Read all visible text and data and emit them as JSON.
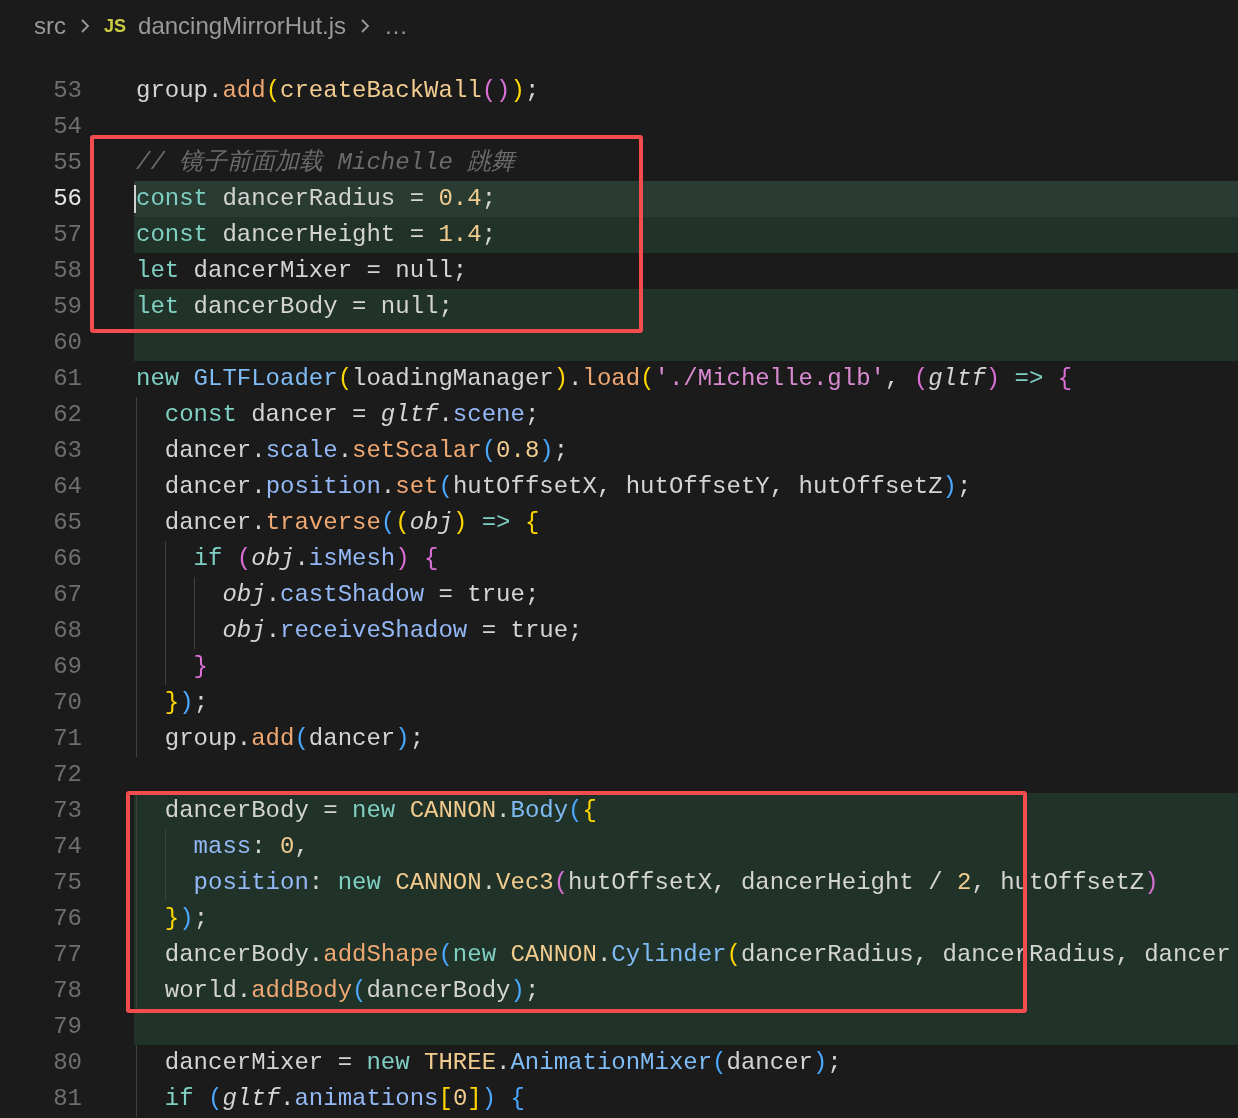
{
  "breadcrumb": {
    "folder": "src",
    "file_badge": "JS",
    "file": "dancingMirrorHut.js",
    "more": "…"
  },
  "blocks": [
    {
      "boxed": false,
      "lines": [
        {
          "number": "53",
          "current": false,
          "added": false,
          "tokens": [
            {
              "kind": "plain",
              "text": "group."
            },
            {
              "kind": "method",
              "text": "add"
            },
            {
              "kind": "b1",
              "text": "("
            },
            {
              "kind": "function",
              "text": "createBackWall"
            },
            {
              "kind": "b2",
              "text": "()"
            },
            {
              "kind": "b1",
              "text": ")"
            },
            {
              "kind": "plain",
              "text": ";"
            }
          ]
        },
        {
          "number": "54",
          "current": false,
          "added": false
        }
      ]
    },
    {
      "boxed": true,
      "lines": [
        {
          "number": "55",
          "current": false,
          "added": false,
          "tokens": [
            {
              "kind": "comment",
              "text": "// 镜子前面加载 Michelle 跳舞"
            }
          ]
        },
        {
          "number": "56",
          "current": true,
          "added": true,
          "tokens": [
            {
              "kind": "keyword",
              "text": "const "
            },
            {
              "kind": "plain",
              "text": "dancerRadius = "
            },
            {
              "kind": "number",
              "text": "0.4"
            },
            {
              "kind": "plain",
              "text": ";"
            }
          ]
        },
        {
          "number": "57",
          "current": false,
          "added": true,
          "tokens": [
            {
              "kind": "keyword",
              "text": "const "
            },
            {
              "kind": "plain",
              "text": "dancerHeight = "
            },
            {
              "kind": "number",
              "text": "1.4"
            },
            {
              "kind": "plain",
              "text": ";"
            }
          ]
        },
        {
          "number": "58",
          "current": false,
          "added": false,
          "tokens": [
            {
              "kind": "keyword",
              "text": "let "
            },
            {
              "kind": "plain",
              "text": "dancerMixer = null;"
            }
          ]
        },
        {
          "number": "59",
          "current": false,
          "added": true,
          "tokens": [
            {
              "kind": "keyword",
              "text": "let "
            },
            {
              "kind": "plain",
              "text": "dancerBody = null;"
            }
          ]
        }
      ]
    },
    {
      "boxed": false,
      "lines": [
        {
          "number": "60",
          "current": false,
          "added": true
        },
        {
          "number": "61",
          "current": false,
          "added": false,
          "tokens": [
            {
              "kind": "keyword",
              "text": "new "
            },
            {
              "kind": "class",
              "text": "GLTFLoader"
            },
            {
              "kind": "b1",
              "text": "("
            },
            {
              "kind": "plain",
              "text": "loadingManager"
            },
            {
              "kind": "b1",
              "text": ")"
            },
            {
              "kind": "plain",
              "text": "."
            },
            {
              "kind": "method",
              "text": "load"
            },
            {
              "kind": "b1",
              "text": "("
            },
            {
              "kind": "string",
              "text": "'./Michelle.glb'"
            },
            {
              "kind": "plain",
              "text": ", "
            },
            {
              "kind": "b2",
              "text": "("
            },
            {
              "kind": "param",
              "text": "gltf"
            },
            {
              "kind": "b2",
              "text": ") "
            },
            {
              "kind": "keyword",
              "text": "=> "
            },
            {
              "kind": "b2",
              "text": "{"
            }
          ]
        },
        {
          "number": "62",
          "current": false,
          "added": false,
          "tokens": [
            {
              "kind": "keyword",
              "text": "  const "
            },
            {
              "kind": "plain",
              "text": "dancer = "
            },
            {
              "kind": "param",
              "text": "gltf"
            },
            {
              "kind": "plain",
              "text": "."
            },
            {
              "kind": "property",
              "text": "scene"
            },
            {
              "kind": "plain",
              "text": ";"
            }
          ]
        },
        {
          "number": "63",
          "current": false,
          "added": false,
          "tokens": [
            {
              "kind": "plain",
              "text": "  dancer."
            },
            {
              "kind": "property",
              "text": "scale"
            },
            {
              "kind": "plain",
              "text": "."
            },
            {
              "kind": "method",
              "text": "setScalar"
            },
            {
              "kind": "b3",
              "text": "("
            },
            {
              "kind": "number",
              "text": "0.8"
            },
            {
              "kind": "b3",
              "text": ")"
            },
            {
              "kind": "plain",
              "text": ";"
            }
          ]
        },
        {
          "number": "64",
          "current": false,
          "added": false,
          "tokens": [
            {
              "kind": "plain",
              "text": "  dancer."
            },
            {
              "kind": "property",
              "text": "position"
            },
            {
              "kind": "plain",
              "text": "."
            },
            {
              "kind": "method",
              "text": "set"
            },
            {
              "kind": "b3",
              "text": "("
            },
            {
              "kind": "plain",
              "text": "hutOffsetX, hutOffsetY, hutOffsetZ"
            },
            {
              "kind": "b3",
              "text": ")"
            },
            {
              "kind": "plain",
              "text": ";"
            }
          ]
        },
        {
          "number": "65",
          "current": false,
          "added": false,
          "tokens": [
            {
              "kind": "plain",
              "text": "  dancer."
            },
            {
              "kind": "method",
              "text": "traverse"
            },
            {
              "kind": "b3",
              "text": "("
            },
            {
              "kind": "b1",
              "text": "("
            },
            {
              "kind": "param",
              "text": "obj"
            },
            {
              "kind": "b1",
              "text": ") "
            },
            {
              "kind": "keyword",
              "text": "=> "
            },
            {
              "kind": "b1",
              "text": "{"
            }
          ]
        },
        {
          "number": "66",
          "current": false,
          "added": false,
          "tokens": [
            {
              "kind": "keyword",
              "text": "    if "
            },
            {
              "kind": "b2",
              "text": "("
            },
            {
              "kind": "param",
              "text": "obj"
            },
            {
              "kind": "plain",
              "text": "."
            },
            {
              "kind": "property",
              "text": "isMesh"
            },
            {
              "kind": "b2",
              "text": ") {"
            }
          ]
        },
        {
          "number": "67",
          "current": false,
          "added": false,
          "tokens": [
            {
              "kind": "param",
              "text": "      obj"
            },
            {
              "kind": "plain",
              "text": "."
            },
            {
              "kind": "property",
              "text": "castShadow"
            },
            {
              "kind": "plain",
              "text": " = true;"
            }
          ]
        },
        {
          "number": "68",
          "current": false,
          "added": false,
          "tokens": [
            {
              "kind": "param",
              "text": "      obj"
            },
            {
              "kind": "plain",
              "text": "."
            },
            {
              "kind": "property",
              "text": "receiveShadow"
            },
            {
              "kind": "plain",
              "text": " = true;"
            }
          ]
        },
        {
          "number": "69",
          "current": false,
          "added": false,
          "tokens": [
            {
              "kind": "b2",
              "text": "    }"
            }
          ]
        },
        {
          "number": "70",
          "current": false,
          "added": false,
          "tokens": [
            {
              "kind": "b1",
              "text": "  }"
            },
            {
              "kind": "b3",
              "text": ")"
            },
            {
              "kind": "plain",
              "text": ";"
            }
          ]
        },
        {
          "number": "71",
          "current": false,
          "added": false,
          "tokens": [
            {
              "kind": "plain",
              "text": "  group."
            },
            {
              "kind": "method",
              "text": "add"
            },
            {
              "kind": "b3",
              "text": "("
            },
            {
              "kind": "plain",
              "text": "dancer"
            },
            {
              "kind": "b3",
              "text": ")"
            },
            {
              "kind": "plain",
              "text": ";"
            }
          ]
        },
        {
          "number": "72",
          "current": false,
          "added": false
        }
      ]
    },
    {
      "boxed": true,
      "lines": [
        {
          "number": "73",
          "current": false,
          "added": true,
          "tokens": [
            {
              "kind": "plain",
              "text": "  dancerBody = "
            },
            {
              "kind": "keyword",
              "text": "new "
            },
            {
              "kind": "namespace",
              "text": "CANNON"
            },
            {
              "kind": "plain",
              "text": "."
            },
            {
              "kind": "class",
              "text": "Body"
            },
            {
              "kind": "b3",
              "text": "("
            },
            {
              "kind": "b1",
              "text": "{"
            }
          ]
        },
        {
          "number": "74",
          "current": false,
          "added": true,
          "tokens": [
            {
              "kind": "property",
              "text": "    mass"
            },
            {
              "kind": "plain",
              "text": ": "
            },
            {
              "kind": "number",
              "text": "0"
            },
            {
              "kind": "plain",
              "text": ","
            }
          ]
        },
        {
          "number": "75",
          "current": false,
          "added": true,
          "tokens": [
            {
              "kind": "property",
              "text": "    position"
            },
            {
              "kind": "plain",
              "text": ": "
            },
            {
              "kind": "keyword",
              "text": "new "
            },
            {
              "kind": "namespace",
              "text": "CANNON"
            },
            {
              "kind": "plain",
              "text": "."
            },
            {
              "kind": "namespace",
              "text": "Vec3"
            },
            {
              "kind": "b2",
              "text": "("
            },
            {
              "kind": "plain",
              "text": "hutOffsetX, dancerHeight / "
            },
            {
              "kind": "number",
              "text": "2"
            },
            {
              "kind": "plain",
              "text": ", hutOffsetZ"
            },
            {
              "kind": "b2",
              "text": ")"
            }
          ]
        },
        {
          "number": "76",
          "current": false,
          "added": true,
          "tokens": [
            {
              "kind": "b1",
              "text": "  }"
            },
            {
              "kind": "b3",
              "text": ")"
            },
            {
              "kind": "plain",
              "text": ";"
            }
          ]
        },
        {
          "number": "77",
          "current": false,
          "added": true,
          "tokens": [
            {
              "kind": "plain",
              "text": "  dancerBody."
            },
            {
              "kind": "method",
              "text": "addShape"
            },
            {
              "kind": "b3",
              "text": "("
            },
            {
              "kind": "keyword",
              "text": "new "
            },
            {
              "kind": "namespace",
              "text": "CANNON"
            },
            {
              "kind": "plain",
              "text": "."
            },
            {
              "kind": "class",
              "text": "Cylinder"
            },
            {
              "kind": "b1",
              "text": "("
            },
            {
              "kind": "plain",
              "text": "dancerRadius, dancerRadius, dancer"
            }
          ]
        },
        {
          "number": "78",
          "current": false,
          "added": true,
          "tokens": [
            {
              "kind": "plain",
              "text": "  world."
            },
            {
              "kind": "method",
              "text": "addBody"
            },
            {
              "kind": "b3",
              "text": "("
            },
            {
              "kind": "plain",
              "text": "dancerBody"
            },
            {
              "kind": "b3",
              "text": ")"
            },
            {
              "kind": "plain",
              "text": ";"
            }
          ]
        }
      ]
    },
    {
      "boxed": false,
      "lines": [
        {
          "number": "79",
          "current": false,
          "added": true
        },
        {
          "number": "80",
          "current": false,
          "added": false,
          "tokens": [
            {
              "kind": "plain",
              "text": "  dancerMixer = "
            },
            {
              "kind": "keyword",
              "text": "new "
            },
            {
              "kind": "namespace",
              "text": "THREE"
            },
            {
              "kind": "plain",
              "text": "."
            },
            {
              "kind": "class",
              "text": "AnimationMixer"
            },
            {
              "kind": "b3",
              "text": "("
            },
            {
              "kind": "plain",
              "text": "dancer"
            },
            {
              "kind": "b3",
              "text": ")"
            },
            {
              "kind": "plain",
              "text": ";"
            }
          ]
        },
        {
          "number": "81",
          "current": false,
          "added": false,
          "tokens": [
            {
              "kind": "keyword",
              "text": "  if "
            },
            {
              "kind": "b3",
              "text": "("
            },
            {
              "kind": "param",
              "text": "gltf"
            },
            {
              "kind": "plain",
              "text": "."
            },
            {
              "kind": "property",
              "text": "animations"
            },
            {
              "kind": "b1",
              "text": "["
            },
            {
              "kind": "number",
              "text": "0"
            },
            {
              "kind": "b1",
              "text": "]"
            },
            {
              "kind": "b3",
              "text": ") {"
            }
          ]
        }
      ]
    }
  ]
}
